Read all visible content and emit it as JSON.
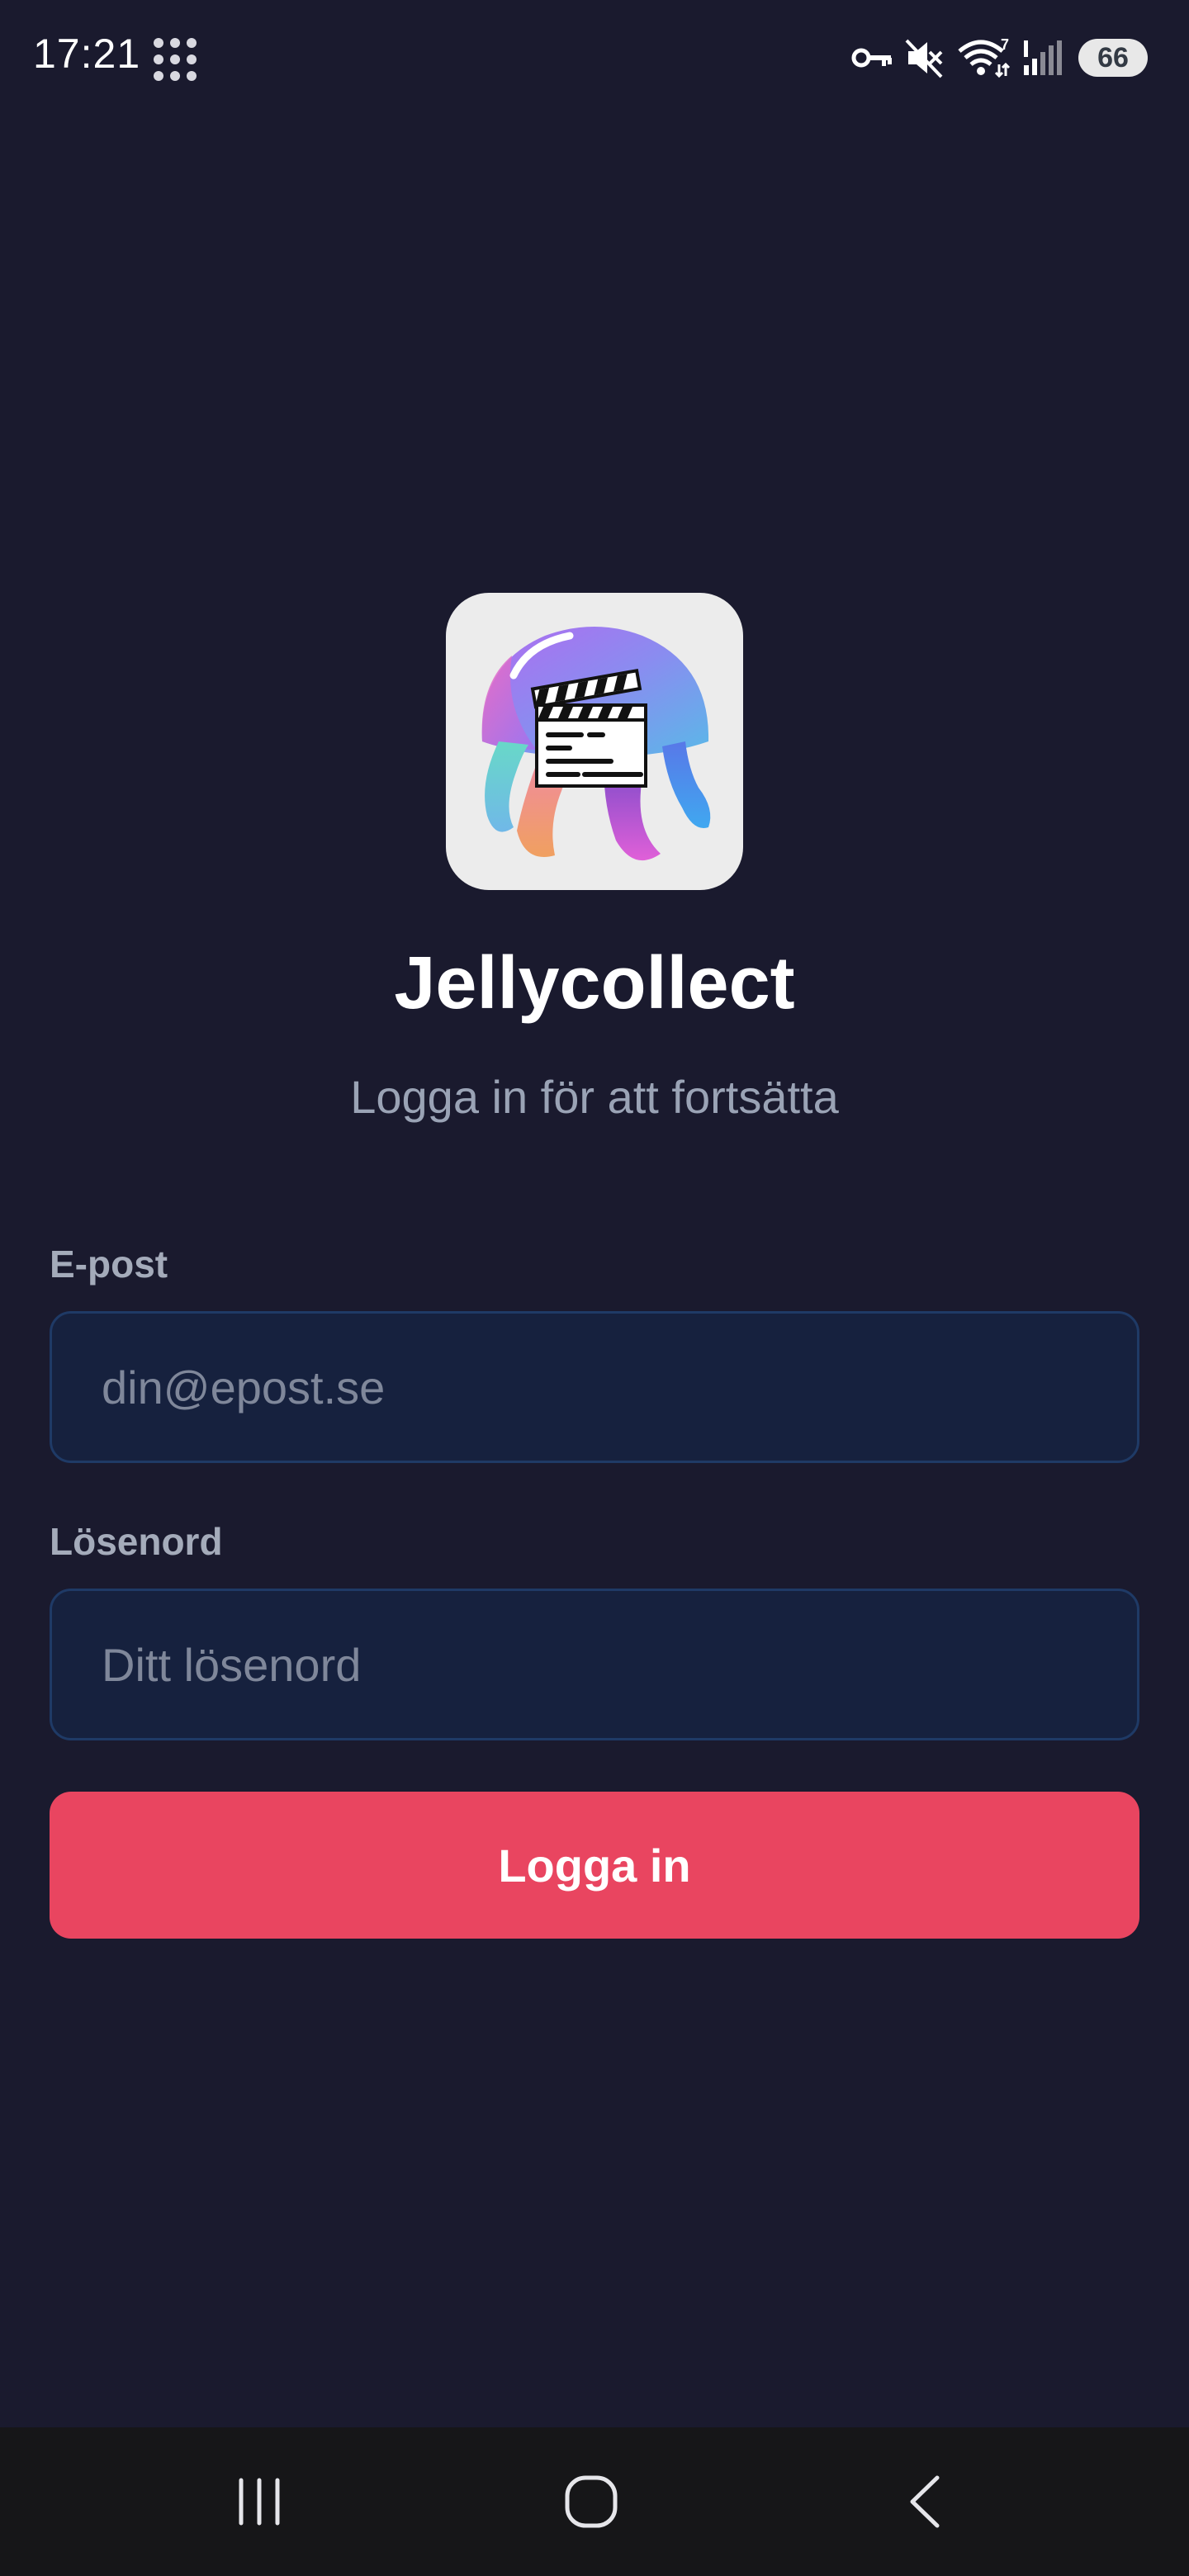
{
  "status_bar": {
    "time": "17:21",
    "wifi_badge": "7",
    "battery": "66",
    "icons": [
      "app-grid-icon",
      "vpn-key-icon",
      "mute-icon",
      "wifi-icon",
      "signal-icon",
      "battery-icon"
    ]
  },
  "app": {
    "logo_icon": "jellyfish-clapperboard-logo",
    "name": "Jellycollect",
    "subtitle": "Logga in för att fortsätta"
  },
  "form": {
    "email_label": "E-post",
    "email_placeholder": "din@epost.se",
    "email_value": "",
    "password_label": "Lösenord",
    "password_placeholder": "Ditt lösenord",
    "password_value": "",
    "submit_label": "Logga in"
  },
  "nav_bar": {
    "icons": [
      "recents-icon",
      "home-icon",
      "back-icon"
    ]
  },
  "colors": {
    "background": "#1a1a2e",
    "input_background": "#16213e",
    "input_border": "#1f3a66",
    "accent": "#e94560",
    "muted_text": "#9aa3b5",
    "nav_background": "#161618"
  }
}
